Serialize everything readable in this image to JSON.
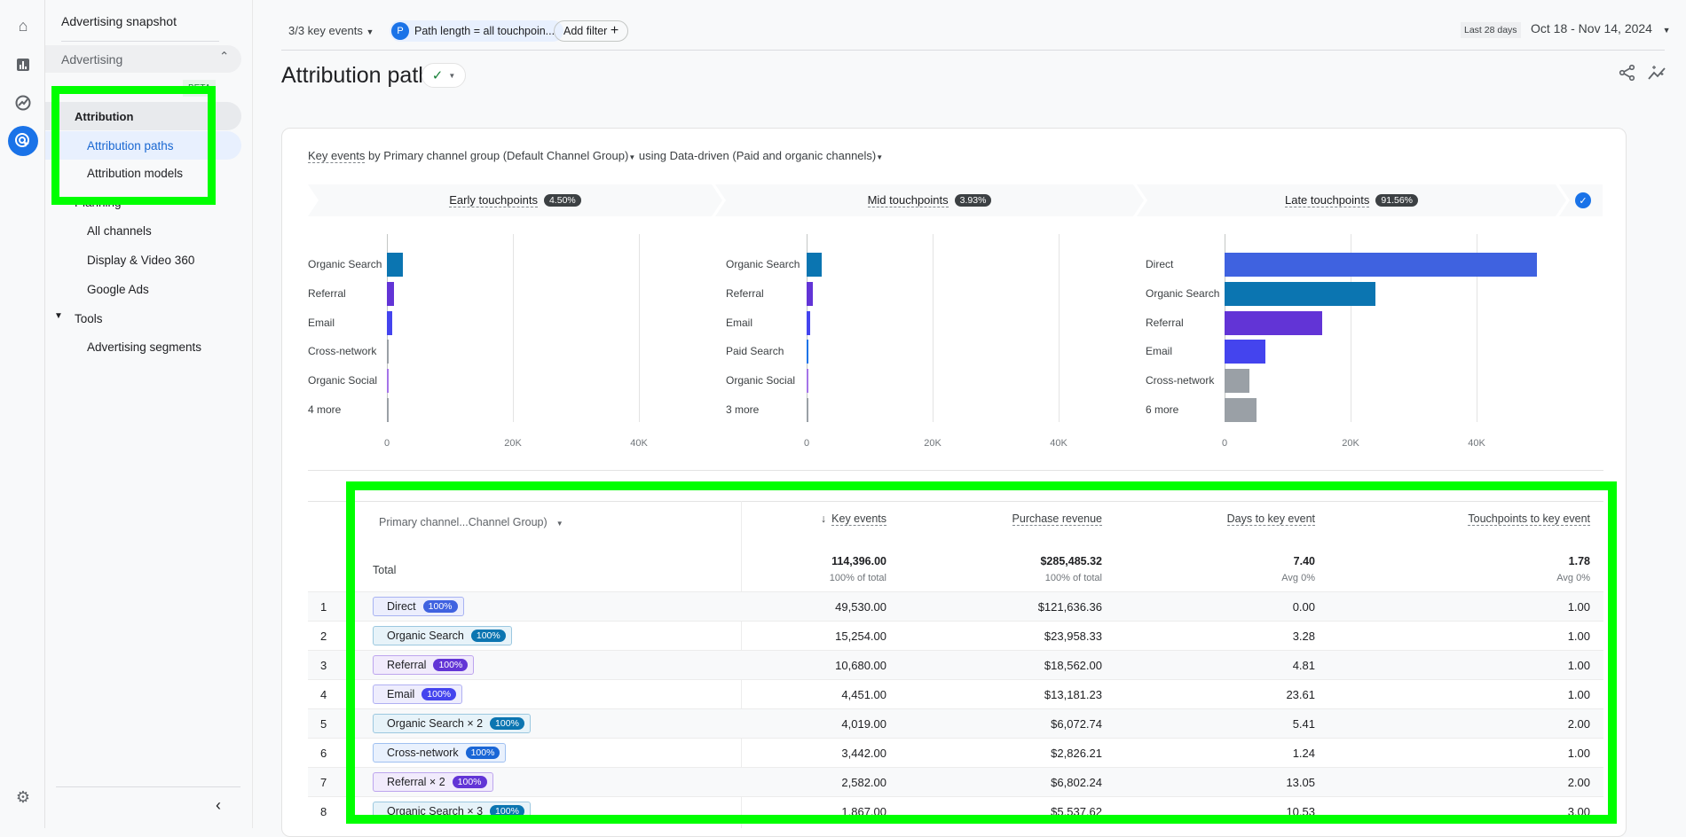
{
  "rail": {
    "icons": [
      "home-icon",
      "reports-icon",
      "explore-icon",
      "advertising-icon"
    ],
    "settings_icon": "gear-icon"
  },
  "sidebar": {
    "snapshot": "Advertising snapshot",
    "group": "Advertising",
    "beta": "BETA",
    "attribution": "Attribution",
    "attribution_paths": "Attribution paths",
    "attribution_models": "Attribution models",
    "planning": "Planning",
    "all_channels": "All channels",
    "dv360": "Display & Video 360",
    "google_ads": "Google Ads",
    "tools": "Tools",
    "segments": "Advertising segments"
  },
  "topbar": {
    "key_events": "3/3 key events",
    "filter_letter": "P",
    "filter": "Path length = all touchpoin...",
    "add_filter": "Add filter",
    "range_badge": "Last 28 days",
    "date_range": "Oct 18 - Nov 14, 2024"
  },
  "page": {
    "title": "Attribution paths"
  },
  "card": {
    "sub_metric": "Key events",
    "sub_by": " by ",
    "sub_dim": "Primary channel group (Default Channel Group)",
    "sub_using": " using ",
    "sub_model": "Data-driven (Paid and organic channels)",
    "tabs": [
      {
        "label": "Early touchpoints",
        "pct": "4.50%"
      },
      {
        "label": "Mid touchpoints",
        "pct": "3.93%"
      },
      {
        "label": "Late touchpoints",
        "pct": "91.56%"
      }
    ]
  },
  "chart_data": [
    {
      "type": "bar",
      "orientation": "horizontal",
      "title": "Early touchpoints",
      "categories": [
        "Organic Search",
        "Referral",
        "Email",
        "Cross-network",
        "Organic Social",
        "4 more"
      ],
      "values": [
        2500,
        1100,
        800,
        250,
        150,
        150
      ],
      "xlim": [
        0,
        50000
      ],
      "ticks": [
        "0",
        "20K",
        "40K"
      ],
      "colors": [
        "#0b75b1",
        "#6234d6",
        "#4444ee",
        "#9aa0a6",
        "#a574e8",
        "#9aa0a6"
      ],
      "grid": true
    },
    {
      "type": "bar",
      "orientation": "horizontal",
      "title": "Mid touchpoints",
      "categories": [
        "Organic Search",
        "Referral",
        "Email",
        "Paid Search",
        "Organic Social",
        "3 more"
      ],
      "values": [
        2400,
        1000,
        500,
        250,
        150,
        150
      ],
      "xlim": [
        0,
        50000
      ],
      "ticks": [
        "0",
        "20K",
        "40K"
      ],
      "colors": [
        "#0b75b1",
        "#6234d6",
        "#4444ee",
        "#1a73e8",
        "#a574e8",
        "#9aa0a6"
      ],
      "grid": true
    },
    {
      "type": "bar",
      "orientation": "horizontal",
      "title": "Late touchpoints",
      "categories": [
        "Direct",
        "Organic Search",
        "Referral",
        "Email",
        "Cross-network",
        "6 more"
      ],
      "values": [
        49530,
        24000,
        15500,
        6500,
        4000,
        5000
      ],
      "xlim": [
        0,
        50000
      ],
      "ticks": [
        "0",
        "20K",
        "40K"
      ],
      "colors": [
        "#3f62e0",
        "#0b75b1",
        "#6234d6",
        "#4444ee",
        "#9aa0a6",
        "#9aa0a6"
      ],
      "grid": true
    }
  ],
  "table": {
    "dim_header": "Primary channel...Channel Group)",
    "headers": [
      "Key events",
      "Purchase revenue",
      "Days to key event",
      "Touchpoints to key event"
    ],
    "total_label": "Total",
    "totals": [
      "114,396.00",
      "$285,485.32",
      "7.40",
      "1.78"
    ],
    "totals_sub": [
      "100% of total",
      "100% of total",
      "Avg 0%",
      "Avg 0%"
    ],
    "rows": [
      {
        "n": "1",
        "path": "Direct",
        "pct": "100%",
        "ch": "direct",
        "v": [
          "49,530.00",
          "$121,636.36",
          "0.00",
          "1.00"
        ]
      },
      {
        "n": "2",
        "path": "Organic Search",
        "pct": "100%",
        "ch": "organic",
        "v": [
          "15,254.00",
          "$23,958.33",
          "3.28",
          "1.00"
        ]
      },
      {
        "n": "3",
        "path": "Referral",
        "pct": "100%",
        "ch": "referral",
        "v": [
          "10,680.00",
          "$18,562.00",
          "4.81",
          "1.00"
        ]
      },
      {
        "n": "4",
        "path": "Email",
        "pct": "100%",
        "ch": "email",
        "v": [
          "4,451.00",
          "$13,181.23",
          "23.61",
          "1.00"
        ]
      },
      {
        "n": "5",
        "path": "Organic Search × 2",
        "pct": "100%",
        "ch": "organic",
        "v": [
          "4,019.00",
          "$6,072.74",
          "5.41",
          "2.00"
        ]
      },
      {
        "n": "6",
        "path": "Cross-network",
        "pct": "100%",
        "ch": "cross",
        "v": [
          "3,442.00",
          "$2,826.21",
          "1.24",
          "1.00"
        ]
      },
      {
        "n": "7",
        "path": "Referral × 2",
        "pct": "100%",
        "ch": "referral",
        "v": [
          "2,582.00",
          "$6,802.24",
          "13.05",
          "2.00"
        ]
      },
      {
        "n": "8",
        "path": "Organic Search × 3",
        "pct": "100%",
        "ch": "organic",
        "v": [
          "1,867.00",
          "$5,537.62",
          "10.53",
          "3.00"
        ]
      }
    ]
  },
  "chip_colors": {
    "direct": [
      "#eceefd",
      "#a8b3f2",
      "#3f62e0"
    ],
    "organic": [
      "#e7f3f9",
      "#9cc8e0",
      "#0b75b1"
    ],
    "referral": [
      "#f1ebfc",
      "#bda5ee",
      "#6234d6"
    ],
    "email": [
      "#eeedfd",
      "#b0b0f3",
      "#4444ee"
    ],
    "cross": [
      "#e9f1fd",
      "#9fc0f1",
      "#1a66d6"
    ]
  },
  "annotation_color": "#00ff00"
}
